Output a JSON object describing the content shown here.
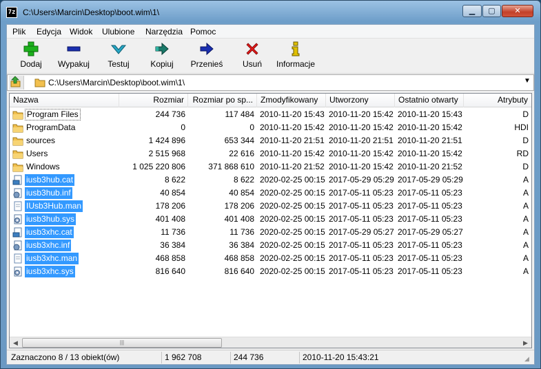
{
  "window": {
    "title": "C:\\Users\\Marcin\\Desktop\\boot.wim\\1\\",
    "app_icon_text": "7z",
    "min_glyph": "▁",
    "max_glyph": "▢",
    "close_glyph": "✕"
  },
  "menu": {
    "items": [
      "Plik",
      "Edycja",
      "Widok",
      "Ulubione",
      "Narzędzia",
      "Pomoc"
    ]
  },
  "toolbar": {
    "buttons": [
      {
        "label": "Dodaj",
        "icon": "plus-icon",
        "color": "#1db11d"
      },
      {
        "label": "Wypakuj",
        "icon": "minus-icon",
        "color": "#1a2fb0"
      },
      {
        "label": "Testuj",
        "icon": "check-chevron-icon",
        "color": "#27a6c4"
      },
      {
        "label": "Kopiuj",
        "icon": "double-arrow-right-icon",
        "color": "#1a7a6a"
      },
      {
        "label": "Przenieś",
        "icon": "arrow-right-icon",
        "color": "#1a2fb0"
      },
      {
        "label": "Usuń",
        "icon": "x-icon",
        "color": "#e01818"
      },
      {
        "label": "Informacje",
        "icon": "info-icon",
        "color": "#e0c000"
      }
    ]
  },
  "address": {
    "path": "C:\\Users\\Marcin\\Desktop\\boot.wim\\1\\"
  },
  "list": {
    "columns": [
      "Nazwa",
      "Rozmiar",
      "Rozmiar po sp...",
      "Zmodyfikowany",
      "Utworzony",
      "Ostatnio otwarty",
      "Atrybuty"
    ],
    "rows": [
      {
        "name": "Program Files",
        "type": "folder",
        "size": "244 736",
        "packed": "117 484",
        "modified": "2010-11-20 15:43",
        "created": "2010-11-20 15:42",
        "accessed": "2010-11-20 15:43",
        "attr": "D",
        "selected": false,
        "focus": true
      },
      {
        "name": "ProgramData",
        "type": "folder",
        "size": "0",
        "packed": "0",
        "modified": "2010-11-20 15:42",
        "created": "2010-11-20 15:42",
        "accessed": "2010-11-20 15:42",
        "attr": "HDI",
        "selected": false,
        "focus": false
      },
      {
        "name": "sources",
        "type": "folder",
        "size": "1 424 896",
        "packed": "653 344",
        "modified": "2010-11-20 21:51",
        "created": "2010-11-20 21:51",
        "accessed": "2010-11-20 21:51",
        "attr": "D",
        "selected": false,
        "focus": false
      },
      {
        "name": "Users",
        "type": "folder",
        "size": "2 515 968",
        "packed": "22 616",
        "modified": "2010-11-20 15:42",
        "created": "2010-11-20 15:42",
        "accessed": "2010-11-20 15:42",
        "attr": "RD",
        "selected": false,
        "focus": false
      },
      {
        "name": "Windows",
        "type": "folder",
        "size": "1 025 220 806",
        "packed": "371 868 610",
        "modified": "2010-11-20 21:52",
        "created": "2010-11-20 15:42",
        "accessed": "2010-11-20 21:52",
        "attr": "D",
        "selected": false,
        "focus": false
      },
      {
        "name": "iusb3hub.cat",
        "type": "cat",
        "size": "8 622",
        "packed": "8 622",
        "modified": "2020-02-25 00:15",
        "created": "2017-05-29 05:29",
        "accessed": "2017-05-29 05:29",
        "attr": "A",
        "selected": true,
        "focus": false
      },
      {
        "name": "iusb3hub.inf",
        "type": "inf",
        "size": "40 854",
        "packed": "40 854",
        "modified": "2020-02-25 00:15",
        "created": "2017-05-11 05:23",
        "accessed": "2017-05-11 05:23",
        "attr": "A",
        "selected": true,
        "focus": false
      },
      {
        "name": "IUsb3Hub.man",
        "type": "file",
        "size": "178 206",
        "packed": "178 206",
        "modified": "2020-02-25 00:15",
        "created": "2017-05-11 05:23",
        "accessed": "2017-05-11 05:23",
        "attr": "A",
        "selected": true,
        "focus": false
      },
      {
        "name": "iusb3hub.sys",
        "type": "sys",
        "size": "401 408",
        "packed": "401 408",
        "modified": "2020-02-25 00:15",
        "created": "2017-05-11 05:23",
        "accessed": "2017-05-11 05:23",
        "attr": "A",
        "selected": true,
        "focus": false
      },
      {
        "name": "iusb3xhc.cat",
        "type": "cat",
        "size": "11 736",
        "packed": "11 736",
        "modified": "2020-02-25 00:15",
        "created": "2017-05-29 05:27",
        "accessed": "2017-05-29 05:27",
        "attr": "A",
        "selected": true,
        "focus": false
      },
      {
        "name": "iusb3xhc.inf",
        "type": "inf",
        "size": "36 384",
        "packed": "36 384",
        "modified": "2020-02-25 00:15",
        "created": "2017-05-11 05:23",
        "accessed": "2017-05-11 05:23",
        "attr": "A",
        "selected": true,
        "focus": false
      },
      {
        "name": "iusb3xhc.man",
        "type": "file",
        "size": "468 858",
        "packed": "468 858",
        "modified": "2020-02-25 00:15",
        "created": "2017-05-11 05:23",
        "accessed": "2017-05-11 05:23",
        "attr": "A",
        "selected": true,
        "focus": false
      },
      {
        "name": "iusb3xhc.sys",
        "type": "sys",
        "size": "816 640",
        "packed": "816 640",
        "modified": "2020-02-25 00:15",
        "created": "2017-05-11 05:23",
        "accessed": "2017-05-11 05:23",
        "attr": "A",
        "selected": true,
        "focus": false
      }
    ]
  },
  "status": {
    "selection": "Zaznaczono 8 / 13 obiekt(ów)",
    "size": "1 962 708",
    "packed": "244 736",
    "date": "2010-11-20 15:43:21"
  },
  "colors": {
    "selection": "#3399ff",
    "folder": "#f2c04e"
  }
}
